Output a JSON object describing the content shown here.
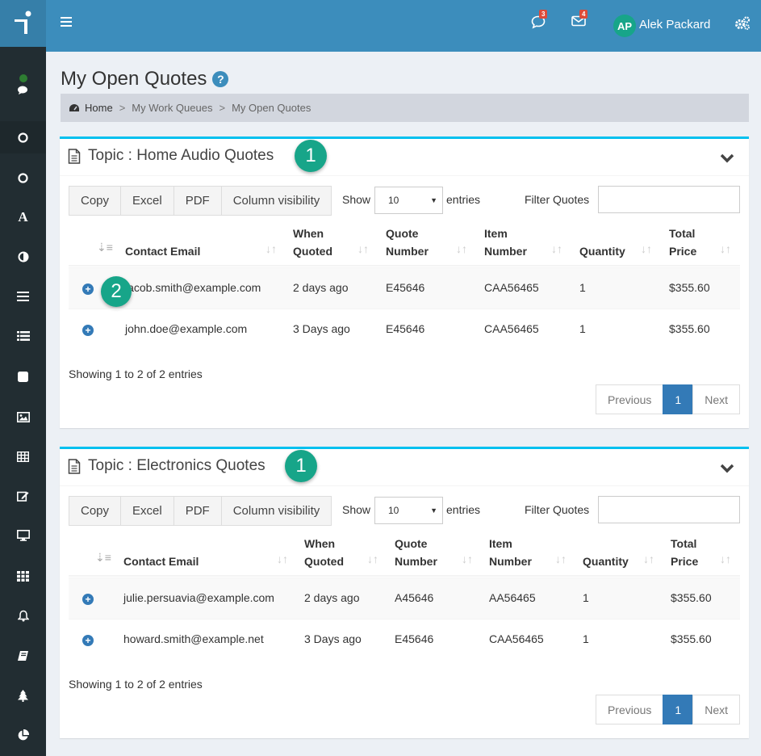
{
  "header": {
    "chat_badge": "3",
    "mail_badge": "4",
    "avatar_initials": "AP",
    "user_name": "Alek Packard"
  },
  "page": {
    "title": "My Open Quotes"
  },
  "breadcrumb": {
    "home": "Home",
    "sep1": ">",
    "item1": "My Work Queues",
    "sep2": ">",
    "item2": "My Open Quotes"
  },
  "toolbar": {
    "copy": "Copy",
    "excel": "Excel",
    "pdf": "PDF",
    "colvis": "Column visibility",
    "show": "Show",
    "page_size": "10",
    "entries": "entries",
    "filter": "Filter Quotes"
  },
  "columns": {
    "email": "Contact Email",
    "when1": "When",
    "when2": "Quoted",
    "quote1": "Quote",
    "quote2": "Number",
    "item1": "Item",
    "item2": "Number",
    "qty": "Quantity",
    "price1": "Total",
    "price2": "Price"
  },
  "pagination": {
    "previous": "Previous",
    "page": "1",
    "next": "Next"
  },
  "panels": [
    {
      "title": "Topic : Home Audio Quotes",
      "step": "1",
      "rows": [
        {
          "email": "jacob.smith@example.com",
          "when": "2 days ago",
          "quote": "E45646",
          "item": "CAA56465",
          "qty": "1",
          "price": "$355.60"
        },
        {
          "email": "john.doe@example.com",
          "when": "3 Days ago",
          "quote": "E45646",
          "item": "CAA56465",
          "qty": "1",
          "price": "$355.60"
        }
      ],
      "info": "Showing 1 to 2 of 2 entries"
    },
    {
      "title": "Topic : Electronics Quotes",
      "step": "1",
      "rows": [
        {
          "email": "julie.persuavia@example.com",
          "when": "2 days ago",
          "quote": "A45646",
          "item": "AA56465",
          "qty": "1",
          "price": "$355.60"
        },
        {
          "email": "howard.smith@example.net",
          "when": "3 Days ago",
          "quote": "E45646",
          "item": "CAA56465",
          "qty": "1",
          "price": "$355.60"
        }
      ],
      "info": "Showing 1 to 2 of 2 entries"
    }
  ],
  "row_step": "2",
  "colors": {
    "header": "#3c8dbc",
    "sidebar": "#222d32",
    "accent": "#17a589",
    "panel_top": "#00c0ef",
    "active_page": "#337ab7"
  }
}
